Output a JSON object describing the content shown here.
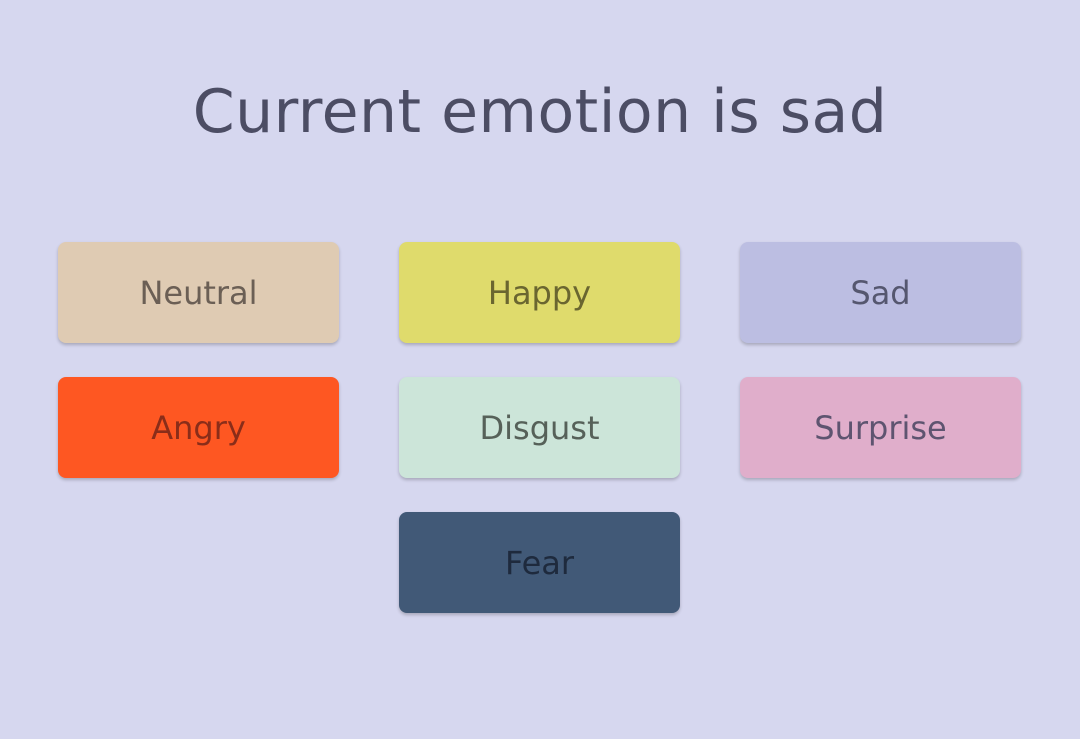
{
  "title": "Current emotion is sad",
  "buttons": [
    {
      "label": "Neutral",
      "color": "#dfcbb3"
    },
    {
      "label": "Happy",
      "color": "#dfdb6c"
    },
    {
      "label": "Sad",
      "color": "#bcbee2"
    },
    {
      "label": "Angry",
      "color": "#fe5722"
    },
    {
      "label": "Disgust",
      "color": "#cce5d9"
    },
    {
      "label": "Surprise",
      "color": "#e0aecb"
    },
    {
      "label": "Fear",
      "color": "#415977"
    }
  ],
  "colors": {
    "background": "#d6d7ef",
    "title_text": "#4c4d64"
  }
}
